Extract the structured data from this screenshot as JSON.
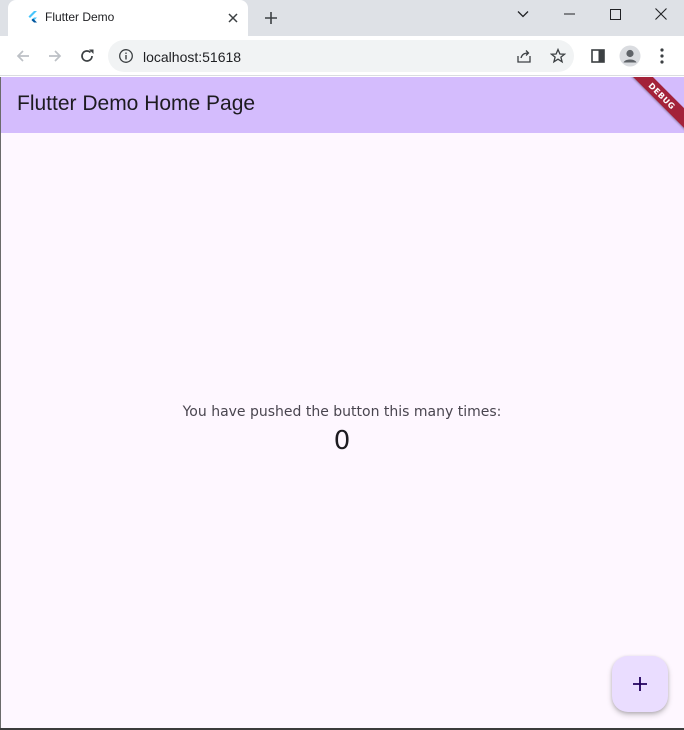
{
  "browser": {
    "tab": {
      "title": "Flutter Demo",
      "favicon": "flutter-logo-icon",
      "close_icon": "close-icon"
    },
    "new_tab_icon": "plus-icon",
    "window_controls": [
      "chevron-down-icon",
      "minimize-icon",
      "maximize-icon",
      "close-icon"
    ],
    "toolbar": {
      "back_icon": "arrow-left-icon",
      "forward_icon": "arrow-right-icon",
      "reload_icon": "reload-icon",
      "site_info_icon": "info-icon",
      "url": "localhost:51618",
      "share_icon": "share-icon",
      "bookmark_icon": "star-icon",
      "side_panel_icon": "side-panel-icon",
      "profile_icon": "profile-icon",
      "menu_icon": "more-vert-icon"
    }
  },
  "app": {
    "appbar_title": "Flutter Demo Home Page",
    "debug_banner": "DEBUG",
    "counter_label": "You have pushed the button this many times:",
    "counter_value": "0",
    "fab_icon": "plus-icon",
    "colors": {
      "appbar_bg": "#d4bcfd",
      "page_bg": "#fef7ff",
      "fab_bg": "#eaddff",
      "debug_banner": "#a3223a"
    }
  }
}
